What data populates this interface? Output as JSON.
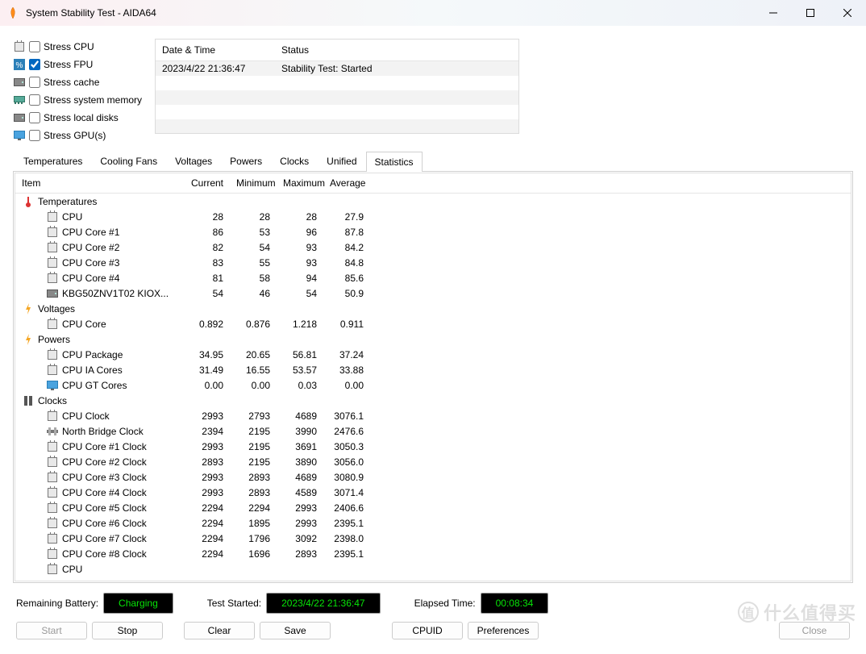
{
  "window": {
    "title": "System Stability Test - AIDA64"
  },
  "stress_options": [
    {
      "icon": "chip-icon",
      "label": "Stress CPU",
      "checked": false
    },
    {
      "icon": "percent-icon",
      "label": "Stress FPU",
      "checked": true
    },
    {
      "icon": "disk-icon",
      "label": "Stress cache",
      "checked": false
    },
    {
      "icon": "ram-icon",
      "label": "Stress system memory",
      "checked": false
    },
    {
      "icon": "hdd-icon",
      "label": "Stress local disks",
      "checked": false
    },
    {
      "icon": "monitor-icon",
      "label": "Stress GPU(s)",
      "checked": false
    }
  ],
  "log": {
    "headers": {
      "datetime": "Date & Time",
      "status": "Status"
    },
    "rows": [
      {
        "datetime": "2023/4/22 21:36:47",
        "status": "Stability Test: Started"
      }
    ]
  },
  "tabs": [
    {
      "label": "Temperatures",
      "active": false
    },
    {
      "label": "Cooling Fans",
      "active": false
    },
    {
      "label": "Voltages",
      "active": false
    },
    {
      "label": "Powers",
      "active": false
    },
    {
      "label": "Clocks",
      "active": false
    },
    {
      "label": "Unified",
      "active": false
    },
    {
      "label": "Statistics",
      "active": true
    }
  ],
  "stats": {
    "headers": {
      "item": "Item",
      "current": "Current",
      "minimum": "Minimum",
      "maximum": "Maximum",
      "average": "Average"
    },
    "groups": [
      {
        "label": "Temperatures",
        "icon": "thermometer-icon",
        "rows": [
          {
            "icon": "chip-icon",
            "label": "CPU",
            "current": "28",
            "minimum": "28",
            "maximum": "28",
            "average": "27.9"
          },
          {
            "icon": "chip-icon",
            "label": "CPU Core #1",
            "current": "86",
            "minimum": "53",
            "maximum": "96",
            "average": "87.8"
          },
          {
            "icon": "chip-icon",
            "label": "CPU Core #2",
            "current": "82",
            "minimum": "54",
            "maximum": "93",
            "average": "84.2"
          },
          {
            "icon": "chip-icon",
            "label": "CPU Core #3",
            "current": "83",
            "minimum": "55",
            "maximum": "93",
            "average": "84.8"
          },
          {
            "icon": "chip-icon",
            "label": "CPU Core #4",
            "current": "81",
            "minimum": "58",
            "maximum": "94",
            "average": "85.6"
          },
          {
            "icon": "hdd-icon",
            "label": "KBG50ZNV1T02 KIOX...",
            "current": "54",
            "minimum": "46",
            "maximum": "54",
            "average": "50.9"
          }
        ]
      },
      {
        "label": "Voltages",
        "icon": "bolt-icon",
        "rows": [
          {
            "icon": "chip-icon",
            "label": "CPU Core",
            "current": "0.892",
            "minimum": "0.876",
            "maximum": "1.218",
            "average": "0.911"
          }
        ]
      },
      {
        "label": "Powers",
        "icon": "bolt-icon",
        "rows": [
          {
            "icon": "chip-icon",
            "label": "CPU Package",
            "current": "34.95",
            "minimum": "20.65",
            "maximum": "56.81",
            "average": "37.24"
          },
          {
            "icon": "chip-icon",
            "label": "CPU IA Cores",
            "current": "31.49",
            "minimum": "16.55",
            "maximum": "53.57",
            "average": "33.88"
          },
          {
            "icon": "monitor-icon",
            "label": "CPU GT Cores",
            "current": "0.00",
            "minimum": "0.00",
            "maximum": "0.03",
            "average": "0.00"
          }
        ]
      },
      {
        "label": "Clocks",
        "icon": "clock-group-icon",
        "rows": [
          {
            "icon": "chip-icon",
            "label": "CPU Clock",
            "current": "2993",
            "minimum": "2793",
            "maximum": "4689",
            "average": "3076.1"
          },
          {
            "icon": "bridge-icon",
            "label": "North Bridge Clock",
            "current": "2394",
            "minimum": "2195",
            "maximum": "3990",
            "average": "2476.6"
          },
          {
            "icon": "chip-icon",
            "label": "CPU Core #1 Clock",
            "current": "2993",
            "minimum": "2195",
            "maximum": "3691",
            "average": "3050.3"
          },
          {
            "icon": "chip-icon",
            "label": "CPU Core #2 Clock",
            "current": "2893",
            "minimum": "2195",
            "maximum": "3890",
            "average": "3056.0"
          },
          {
            "icon": "chip-icon",
            "label": "CPU Core #3 Clock",
            "current": "2993",
            "minimum": "2893",
            "maximum": "4689",
            "average": "3080.9"
          },
          {
            "icon": "chip-icon",
            "label": "CPU Core #4 Clock",
            "current": "2993",
            "minimum": "2893",
            "maximum": "4589",
            "average": "3071.4"
          },
          {
            "icon": "chip-icon",
            "label": "CPU Core #5 Clock",
            "current": "2294",
            "minimum": "2294",
            "maximum": "2993",
            "average": "2406.6"
          },
          {
            "icon": "chip-icon",
            "label": "CPU Core #6 Clock",
            "current": "2294",
            "minimum": "1895",
            "maximum": "2993",
            "average": "2395.1"
          },
          {
            "icon": "chip-icon",
            "label": "CPU Core #7 Clock",
            "current": "2294",
            "minimum": "1796",
            "maximum": "3092",
            "average": "2398.0"
          },
          {
            "icon": "chip-icon",
            "label": "CPU Core #8 Clock",
            "current": "2294",
            "minimum": "1696",
            "maximum": "2893",
            "average": "2395.1"
          },
          {
            "icon": "chip-icon",
            "label": "CPU",
            "current": "",
            "minimum": "",
            "maximum": "",
            "average": ""
          }
        ]
      }
    ]
  },
  "status": {
    "battery_label": "Remaining Battery:",
    "battery_value": "Charging",
    "started_label": "Test Started:",
    "started_value": "2023/4/22 21:36:47",
    "elapsed_label": "Elapsed Time:",
    "elapsed_value": "00:08:34"
  },
  "buttons": {
    "start": "Start",
    "stop": "Stop",
    "clear": "Clear",
    "save": "Save",
    "cpuid": "CPUID",
    "preferences": "Preferences",
    "close": "Close"
  },
  "watermark": "什么值得买"
}
